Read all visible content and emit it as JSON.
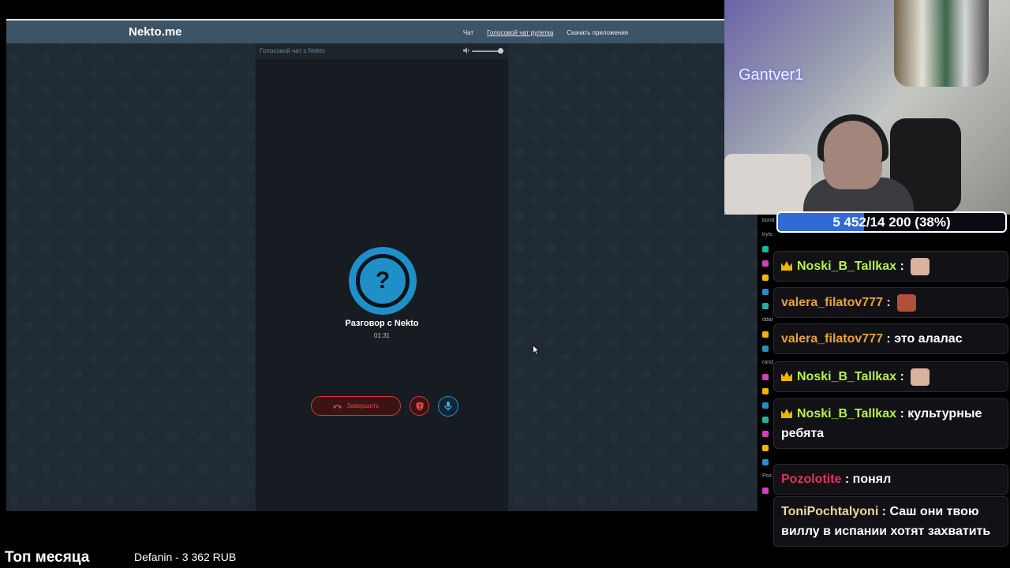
{
  "site": {
    "logo": "Nekto.me",
    "nav": [
      "Чат",
      "Голосовой чат рулетка",
      "Скачать приложения"
    ],
    "active_nav_index": 1
  },
  "call_panel": {
    "title": "Голосовой чат с Nekto",
    "volume_level": 1.0,
    "avatar_glyph": "?",
    "call_title": "Разговор с Nekto",
    "timer": "01:31",
    "end_label": "Завершить",
    "icons": {
      "end": "hangup-icon",
      "report": "shield-icon",
      "mic": "microphone-icon",
      "volume": "speaker-icon"
    }
  },
  "webcam": {
    "streamer_name": "Gantver1"
  },
  "goal": {
    "text": "5 452/14 200 (38%)",
    "progress": 0.38
  },
  "chat": {
    "messages": [
      {
        "user": "Noski_B_Tallkax",
        "color": "#b8f04a",
        "badge": "crown-icon",
        "sep": " : ",
        "text": "",
        "emote": "face-emote"
      },
      {
        "user": "valera_filatov777",
        "color": "#e6a23c",
        "badge": "",
        "sep": " : ",
        "text": "",
        "emote": "face-emote"
      },
      {
        "user": "valera_filatov777",
        "color": "#e6a23c",
        "badge": "",
        "sep": " : ",
        "text": "это алалас",
        "emote": ""
      },
      {
        "user": "Noski_B_Tallkax",
        "color": "#b8f04a",
        "badge": "crown-icon",
        "sep": " : ",
        "text": "",
        "emote": "face-emote"
      },
      {
        "user": "Noski_B_Tallkax",
        "color": "#b8f04a",
        "badge": "crown-icon",
        "sep": " : ",
        "text": "культурные ребята",
        "emote": ""
      },
      {
        "user": "Pozolotite",
        "color": "#e0345a",
        "badge": "",
        "sep": " : ",
        "text": "понял",
        "emote": ""
      },
      {
        "user": "ToniPochtalyoni",
        "color": "#e8d7a0",
        "badge": "",
        "sep": " : ",
        "text": "Саш они твою виллу в испании хотят захватить",
        "emote": ""
      }
    ]
  },
  "mini_chat": [
    "borid",
    "trytc",
    "",
    "",
    "",
    "",
    "",
    "ddar",
    "",
    "",
    "rand",
    "",
    "",
    "",
    "",
    "",
    "",
    "",
    "Poz",
    ""
  ],
  "bottom": {
    "title": "Топ месяца",
    "donor": "Defanin - 3 362 RUB"
  }
}
